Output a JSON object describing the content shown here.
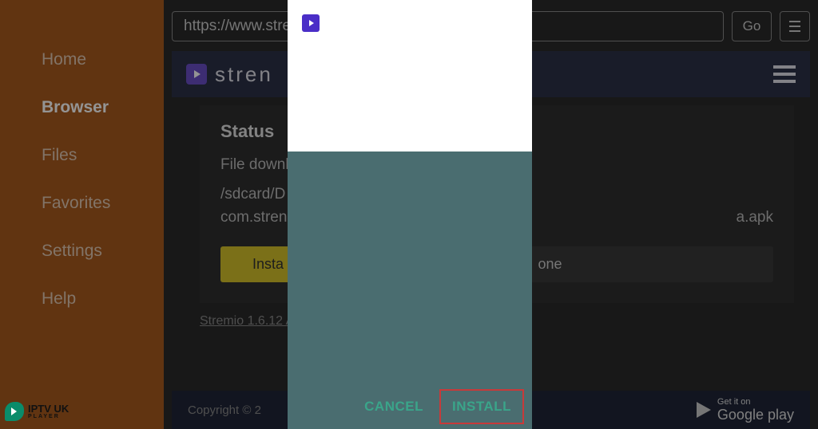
{
  "sidebar": {
    "items": [
      {
        "label": "Home"
      },
      {
        "label": "Browser"
      },
      {
        "label": "Files"
      },
      {
        "label": "Favorites"
      },
      {
        "label": "Settings"
      },
      {
        "label": "Help"
      }
    ]
  },
  "urlbar": {
    "value": "https://www.stre",
    "go": "Go"
  },
  "site": {
    "logo_text": "stren"
  },
  "status": {
    "title": "Status",
    "text": "File downl",
    "path_line1": "/sdcard/D",
    "path_line2": "com.stren",
    "path_suffix": "a.apk",
    "install": "Insta",
    "done": "one"
  },
  "download_link": "Stremio 1.6.12 A",
  "footer": {
    "copyright": "Copyright © 2",
    "gplay_small": "Get it on",
    "gplay_big": "Google play"
  },
  "modal": {
    "cancel": "CANCEL",
    "install": "INSTALL"
  },
  "watermark": {
    "main": "IPTV UK",
    "sub": "PLAYER"
  }
}
